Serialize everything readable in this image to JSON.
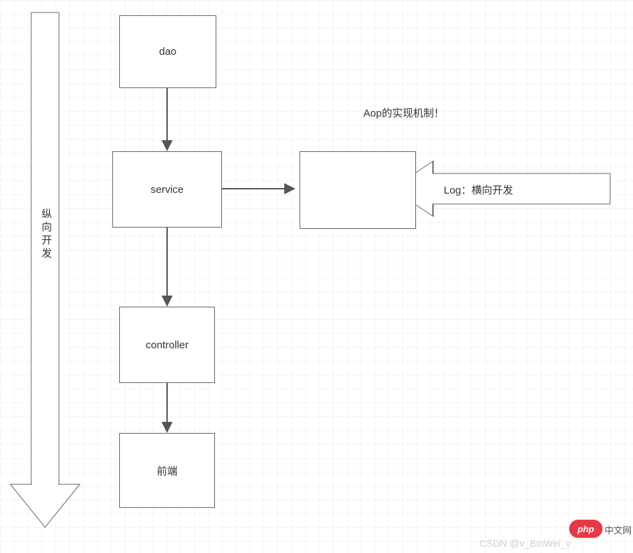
{
  "diagram": {
    "title_annotation": "Aop的实现机制！",
    "vertical_axis_label": "纵向开发",
    "horizontal_arrow_label": "Log：横向开发",
    "boxes": {
      "dao": "dao",
      "service": "service",
      "controller": "controller",
      "frontend": "前端"
    }
  },
  "watermark": {
    "csdn": "CSDN @v_BinWei_v",
    "php": "php",
    "cn": "中文网"
  }
}
